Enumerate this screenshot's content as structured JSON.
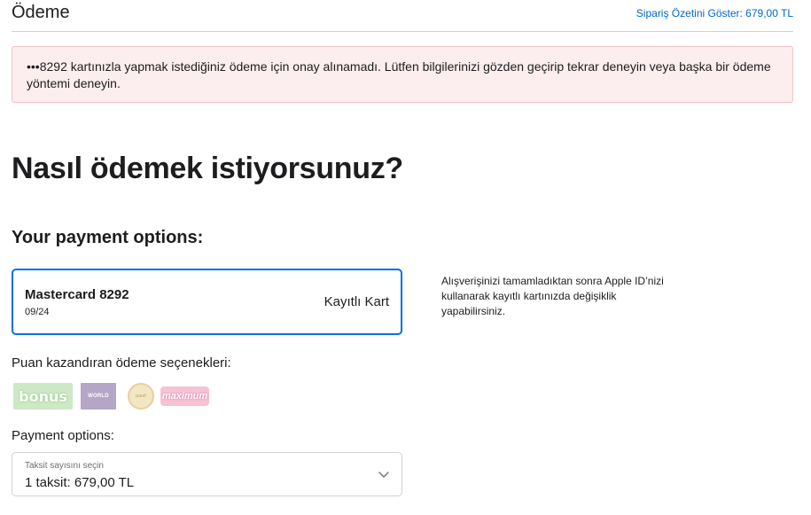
{
  "header": {
    "title": "Ödeme",
    "summary_link": "Sipariş Özetini Göster: 679,00 TL"
  },
  "alert": {
    "message": "•••8292 kartınızla yapmak istediğiniz ödeme için onay alınamadı. Lütfen bilgilerinizi gözden geçirip tekrar deneyin veya başka bir ödeme yöntemi deneyin."
  },
  "page_title": "Nasıl ödemek istiyorsunuz?",
  "payment_options_title": "Your payment options:",
  "saved_card": {
    "name": "Mastercard 8292",
    "expiry": "09/24",
    "type": "Kayıtlı Kart"
  },
  "side_note": "Alışverişinizi tamamladıktan sonra Apple ID’nizi kullanarak kayıtlı kartınızda değişiklik yapabilirsiniz.",
  "points_label": "Puan kazandıran ödeme seçenekleri:",
  "point_logos": [
    {
      "name": "bonus",
      "text": "bonus"
    },
    {
      "name": "world",
      "text": "WORLD"
    },
    {
      "name": "paraf",
      "text": "paraf"
    },
    {
      "name": "maximum",
      "text": "maximum"
    }
  ],
  "installments": {
    "label": "Payment options:",
    "caption": "Taksit sayısını seçin",
    "value": "1 taksit: 679,00 TL"
  },
  "colors": {
    "accent": "#0071e3",
    "link": "#0066cc",
    "alert_bg": "#fcedee"
  }
}
